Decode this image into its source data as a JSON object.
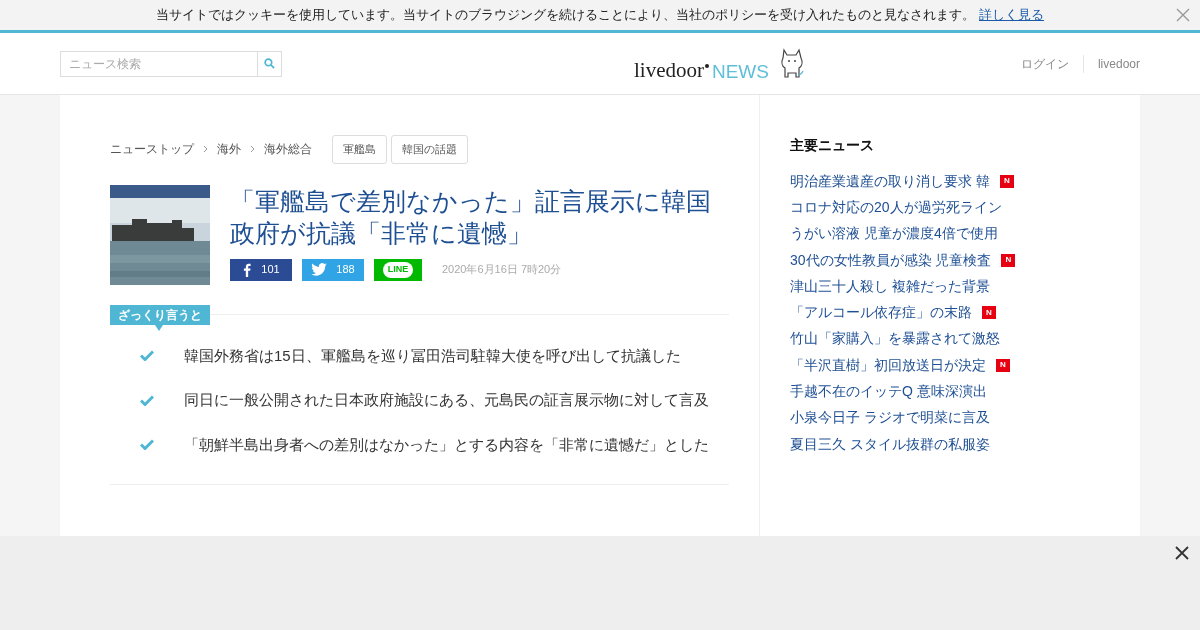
{
  "cookie_bar": {
    "message": "当サイトではクッキーを使用しています。当サイトのブラウジングを続けることにより、当社のポリシーを受け入れたものと見なされます。",
    "link": "詳しく見る"
  },
  "header": {
    "search": {
      "placeholder": "ニュース検索"
    },
    "logo": {
      "brand": "livedoor",
      "product": "NEWS"
    },
    "links": [
      "ログイン",
      "livedoor"
    ]
  },
  "breadcrumbs": [
    "ニューストップ",
    "海外",
    "海外総合"
  ],
  "tags": [
    "軍艦島",
    "韓国の話題"
  ],
  "article": {
    "title": "「軍艦島で差別なかった」証言展示に韓国政府が抗議「非常に遺憾」",
    "shares": [
      {
        "kind": "facebook",
        "count": "101"
      },
      {
        "kind": "twitter",
        "count": "188"
      },
      {
        "kind": "line",
        "count": "LINE"
      }
    ],
    "date": "2020年6月16日 7時20分",
    "summary_label": "ざっくり言うと",
    "summary": [
      "韓国外務省は15日、軍艦島を巡り冨田浩司駐韓大使を呼び出して抗議した",
      "同日に一般公開された日本政府施設にある、元島民の証言展示物に対して言及",
      "「朝鮮半島出身者への差別はなかった」とする内容を「非常に遺憾だ」とした"
    ]
  },
  "sidebar": {
    "title": "主要ニュース",
    "items": [
      {
        "title": "明治産業遺産の取り消し要求 韓",
        "badge": "N"
      },
      {
        "title": "コロナ対応の20人が過労死ライン"
      },
      {
        "title": "うがい溶液 児童が濃度4倍で使用"
      },
      {
        "title": "30代の女性教員が感染 児童検査",
        "badge": "N"
      },
      {
        "title": "津山三十人殺し 複雑だった背景"
      },
      {
        "title": "「アルコール依存症」の末路",
        "badge": "N"
      },
      {
        "title": "竹山「家購入」を暴露されて激怒"
      },
      {
        "title": "「半沢直樹」初回放送日が決定",
        "badge": "N"
      },
      {
        "title": "手越不在のイッテQ 意味深演出"
      },
      {
        "title": "小泉今日子 ラジオで明菜に言及"
      },
      {
        "title": "夏目三久 スタイル抜群の私服姿"
      }
    ]
  }
}
